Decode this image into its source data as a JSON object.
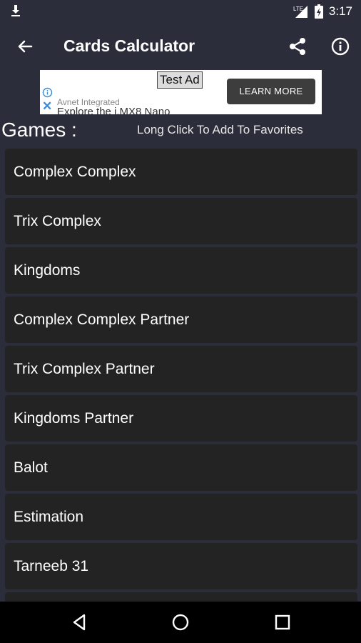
{
  "status_bar": {
    "time": "3:17",
    "network": "LTE"
  },
  "app_bar": {
    "title": "Cards Calculator"
  },
  "ad": {
    "test_label": "Test Ad",
    "advertiser": "Avnet Integrated",
    "headline": "Explore the i.MX8 Nano",
    "cta": "LEARN MORE"
  },
  "section": {
    "title": "Games :",
    "hint": "Long Click To Add To Favorites"
  },
  "games": [
    "Complex Complex",
    "Trix Complex",
    "Kingdoms",
    "Complex Complex Partner",
    "Trix Complex Partner",
    "Kingdoms Partner",
    "Balot",
    "Estimation",
    "Tarneeb 31",
    ""
  ],
  "colors": {
    "background": "#2b2e3a",
    "list_item": "#232323",
    "nav_bar": "#000000",
    "ad_button": "#3d3d3d"
  },
  "icons": {
    "back": "arrow-left-icon",
    "share": "share-icon",
    "info": "info-icon",
    "download": "download-icon",
    "signal": "signal-icon",
    "battery": "battery-icon",
    "nav_back": "triangle-back-icon",
    "nav_home": "circle-home-icon",
    "nav_recents": "square-recents-icon"
  }
}
